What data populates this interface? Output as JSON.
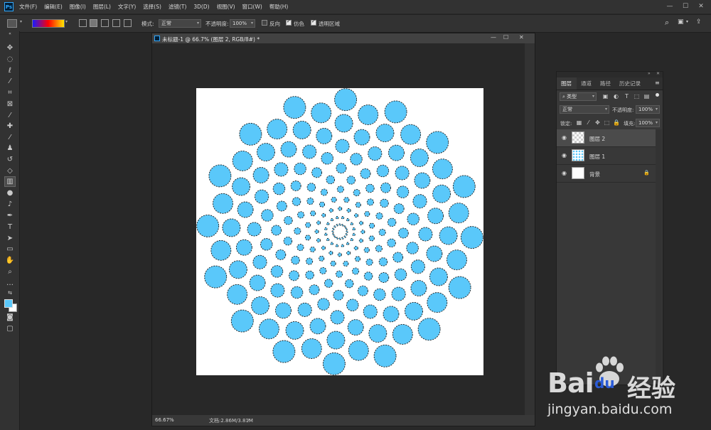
{
  "app": {
    "logo_text": "Ps",
    "menu": [
      "文件(F)",
      "编辑(E)",
      "图像(I)",
      "图层(L)",
      "文字(Y)",
      "选择(S)",
      "滤镜(T)",
      "3D(D)",
      "视图(V)",
      "窗口(W)",
      "帮助(H)"
    ],
    "window_controls": {
      "minimize": "—",
      "maximize": "☐",
      "close": "✕"
    }
  },
  "options_bar": {
    "mode_label": "模式:",
    "mode_value": "正常",
    "opacity_label": "不透明度:",
    "opacity_value": "100%",
    "reverse_label": "反向",
    "reverse_checked": false,
    "dither_label": "仿色",
    "dither_checked": true,
    "transparency_label": "透明区域",
    "transparency_checked": true,
    "gradient_colors": [
      "#1a1aff",
      "#ff0000",
      "#ffe600"
    ]
  },
  "document": {
    "title": "未标题-1 @ 66.7% (图层 2, RGB/8#) *",
    "zoom": "66.67%",
    "doc_info": "文档:2.86M/3.81M",
    "status_arrow": "›",
    "dot_color": "#5ac8fa"
  },
  "layers_panel": {
    "tabs": [
      "图层",
      "通道",
      "路径",
      "历史记录"
    ],
    "active_tab": "图层",
    "filter_label": "类型",
    "blend_mode": "正常",
    "opacity_label": "不透明度:",
    "opacity_value": "100%",
    "lock_label": "锁定:",
    "fill_label": "填充:",
    "fill_value": "100%",
    "layers": [
      {
        "name": "图层 2",
        "selected": true,
        "thumb": "transparent"
      },
      {
        "name": "图层 1",
        "selected": false,
        "thumb": "dots"
      },
      {
        "name": "背景",
        "selected": false,
        "thumb": "white",
        "locked": true
      }
    ]
  },
  "colors": {
    "foreground": "#5ac8fa",
    "background": "#ffffff"
  },
  "watermark": {
    "brand": "Bai",
    "brand2": "du",
    "chinese": "经验",
    "url": "jingyan.baidu.com"
  }
}
